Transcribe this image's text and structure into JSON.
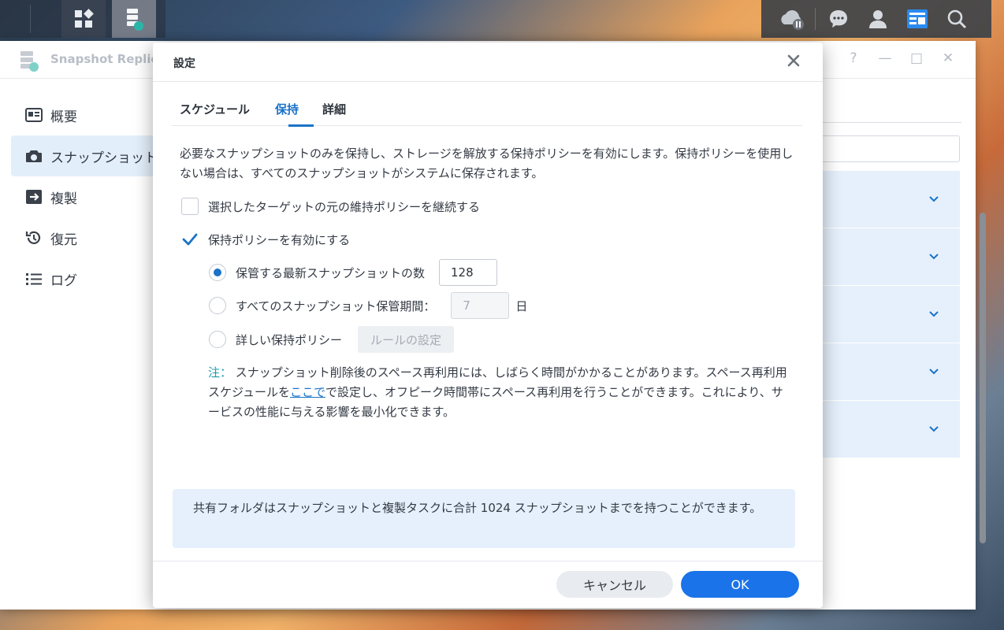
{
  "app": {
    "title": "Snapshot Replic",
    "sidebar": [
      {
        "label": "概要",
        "icon": "overview-icon"
      },
      {
        "label": "スナップショット",
        "icon": "camera-icon",
        "active": true
      },
      {
        "label": "複製",
        "icon": "replication-icon"
      },
      {
        "label": "復元",
        "icon": "restore-icon"
      },
      {
        "label": "ログ",
        "icon": "log-icon"
      }
    ],
    "window_controls": {
      "help": "?",
      "minimize": "—",
      "maximize": "□",
      "close": "✕"
    }
  },
  "dialog": {
    "title": "設定",
    "tabs": [
      {
        "label": "スケジュール"
      },
      {
        "label": "保持",
        "active": true
      },
      {
        "label": "詳細"
      }
    ],
    "description": "必要なスナップショットのみを保持し、ストレージを解放する保持ポリシーを有効にします。保持ポリシーを使用しない場合は、すべてのスナップショットがシステムに保存されます。",
    "inherit_policy": {
      "label": "選択したターゲットの元の維持ポリシーを継続する",
      "checked": false
    },
    "enable_policy": {
      "label": "保持ポリシーを有効にする",
      "checked": true
    },
    "options": {
      "latest_count": {
        "label": "保管する最新スナップショットの数",
        "value": "128",
        "selected": true
      },
      "retention_period": {
        "label": "すべてのスナップショット保管期間：",
        "value": "7",
        "unit": "日",
        "selected": false
      },
      "advanced": {
        "label": "詳しい保持ポリシー",
        "button": "ルールの設定",
        "selected": false
      }
    },
    "note": {
      "prefix": "注：",
      "text1": "スナップショット削除後のスペース再利用には、しばらく時間がかかることがあります。スペース再利用スケジュールを",
      "link": "ここで",
      "text2": "で設定し、オフピーク時間帯にスペース再利用を行うことができます。これにより、サービスの性能に与える影響を最小化できます。"
    },
    "info": "共有フォルダはスナップショットと複製タスクに合計 1024 スナップショットまでを持つことができます。",
    "buttons": {
      "cancel": "キャンセル",
      "ok": "OK"
    }
  },
  "colors": {
    "accent": "#1a73c8",
    "ok_button": "#1a73e8",
    "info_bg": "#e6f0fc",
    "note_prefix": "#1a9ba8"
  }
}
